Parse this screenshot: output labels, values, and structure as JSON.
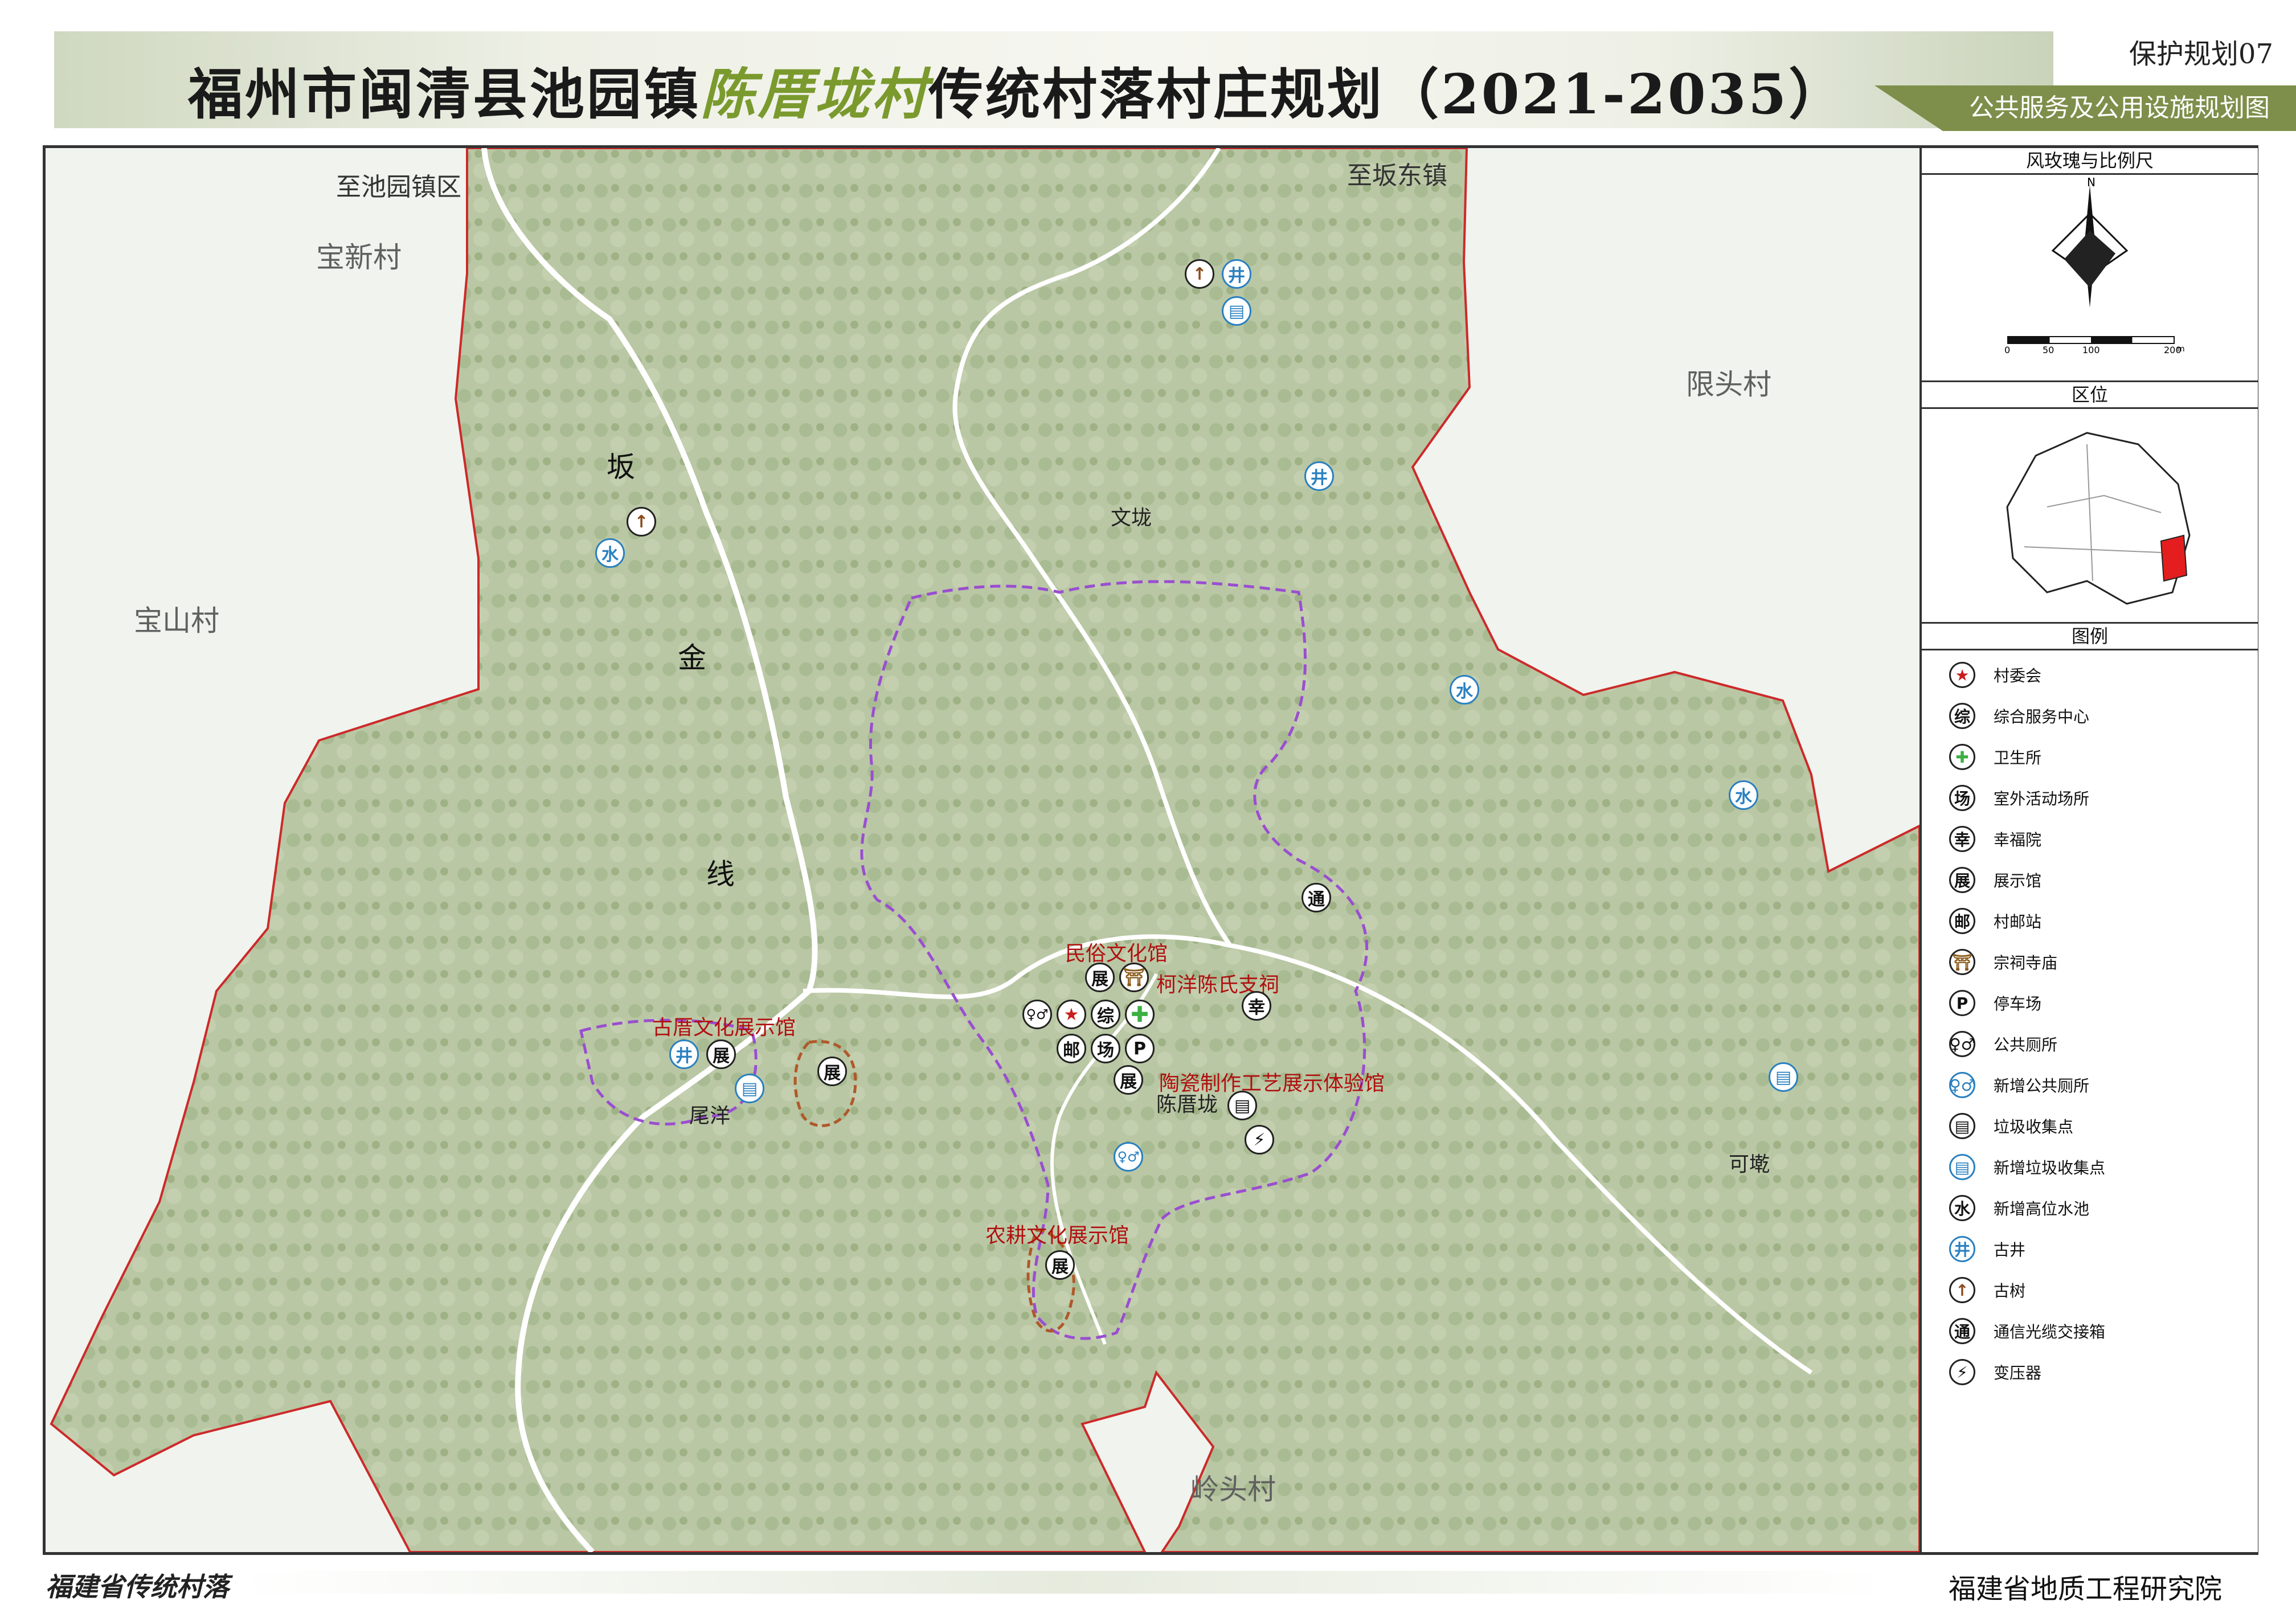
{
  "header": {
    "title_part1": "福州市闽清县池园镇",
    "title_highlight": "陈厝垅村",
    "title_part2": "传统村落村庄规划（2021-2035）",
    "plan_tag": "保护规划07",
    "subtitle": "公共服务及公用设施规划图"
  },
  "side_panel": {
    "compass_title": "风玫瑰与比例尺",
    "north_label": "N",
    "scale_ticks": [
      "0",
      "50",
      "100",
      "200"
    ],
    "scale_unit": "m",
    "location_title": "区位",
    "legend_title": "图例",
    "legend_items": [
      {
        "symbol": "★",
        "icon": "village-committee-icon",
        "label": "村委会",
        "color": "#c81e1e"
      },
      {
        "symbol": "综",
        "icon": "service-center-icon",
        "label": "综合服务中心",
        "color": "#111111"
      },
      {
        "symbol": "✚",
        "icon": "clinic-icon",
        "label": "卫生所",
        "color": "#3cb043"
      },
      {
        "symbol": "场",
        "icon": "activity-ground-icon",
        "label": "室外活动场所",
        "color": "#111111"
      },
      {
        "symbol": "幸",
        "icon": "happiness-home-icon",
        "label": "幸福院",
        "color": "#111111"
      },
      {
        "symbol": "展",
        "icon": "exhibition-hall-icon",
        "label": "展示馆",
        "color": "#111111"
      },
      {
        "symbol": "邮",
        "icon": "post-office-icon",
        "label": "村邮站",
        "color": "#111111"
      },
      {
        "symbol": "⛩",
        "icon": "ancestral-temple-icon",
        "label": "宗祠寺庙",
        "color": "#8a5a1a"
      },
      {
        "symbol": "P",
        "icon": "parking-icon",
        "label": "停车场",
        "color": "#111111"
      },
      {
        "symbol": "♀♂",
        "icon": "public-toilet-icon",
        "label": "公共厕所",
        "color": "#111111"
      },
      {
        "symbol": "♀♂",
        "icon": "new-toilet-icon",
        "label": "新增公共厕所",
        "color": "#2a80c0"
      },
      {
        "symbol": "▤",
        "icon": "garbage-point-icon",
        "label": "垃圾收集点",
        "color": "#111111"
      },
      {
        "symbol": "▤",
        "icon": "new-garbage-point-icon",
        "label": "新增垃圾收集点",
        "color": "#2a80c0"
      },
      {
        "symbol": "水",
        "icon": "water-tank-icon",
        "label": "新增高位水池",
        "color": "#111111"
      },
      {
        "symbol": "井",
        "icon": "ancient-well-icon",
        "label": "古井",
        "color": "#2a80c0"
      },
      {
        "symbol": "↑",
        "icon": "ancient-tree-icon",
        "label": "古树",
        "color": "#8a4a1a"
      },
      {
        "symbol": "通",
        "icon": "telecom-box-icon",
        "label": "通信光缆交接箱",
        "color": "#111111"
      },
      {
        "symbol": "⚡",
        "icon": "transformer-icon",
        "label": "变压器",
        "color": "#111111"
      }
    ]
  },
  "map": {
    "direction_labels": [
      "至池园镇区",
      "至坂东镇"
    ],
    "neighbor_villages": [
      "宝新村",
      "宝山村",
      "限头村",
      "岭头村"
    ],
    "road_name_chars": [
      "坂",
      "金",
      "线"
    ],
    "place_names": [
      "文垅",
      "尾洋",
      "陈厝垅",
      "可墘"
    ],
    "facility_names": [
      "民俗文化馆",
      "柯洋陈氏支祠",
      "古厝文化展示馆",
      "陶瓷制作工艺展示体验馆",
      "农耕文化展示馆"
    ]
  },
  "footer": {
    "left_text": "福建省传统村落",
    "right_text": "福建省地质工程研究院"
  }
}
